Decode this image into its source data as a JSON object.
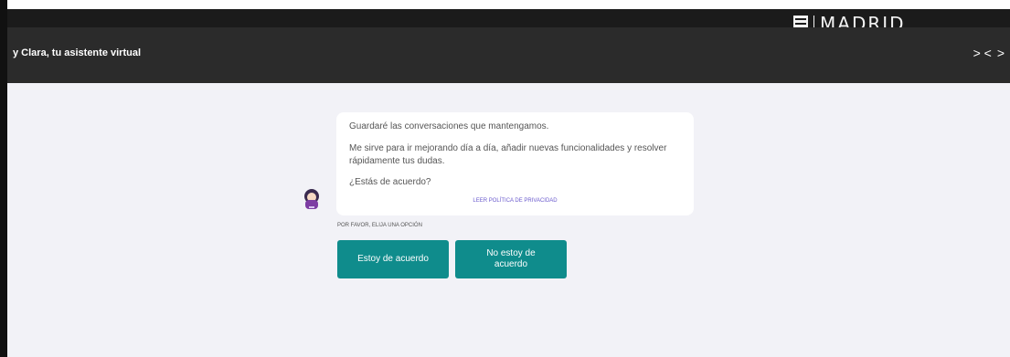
{
  "brand": {
    "name": "MADRID"
  },
  "header": {
    "title": "y Clara, tu asistente virtual",
    "controls": [
      "> <",
      ">"
    ]
  },
  "chat": {
    "message_line1": "Guardaré las conversaciones que mantengamos.",
    "message_line2": "Me sirve para ir mejorando día a día, añadir nuevas funcionalidades y resolver rápidamente tus dudas.",
    "message_line3": "¿Estás de acuerdo?",
    "privacy_link": "LEER POLÍTICA DE PRIVACIDAD"
  },
  "options": {
    "prompt": "POR FAVOR, ELIJA UNA OPCIÓN",
    "agree_label": "Estoy de acuerdo",
    "disagree_label": "No estoy de acuerdo"
  },
  "colors": {
    "header_bg": "#2b2b2b",
    "content_bg": "#f2f2f7",
    "button_bg": "#0f8c8c",
    "link": "#6a5acd"
  },
  "icons": [
    "madrid-logo-icon",
    "assistant-avatar-icon"
  ]
}
